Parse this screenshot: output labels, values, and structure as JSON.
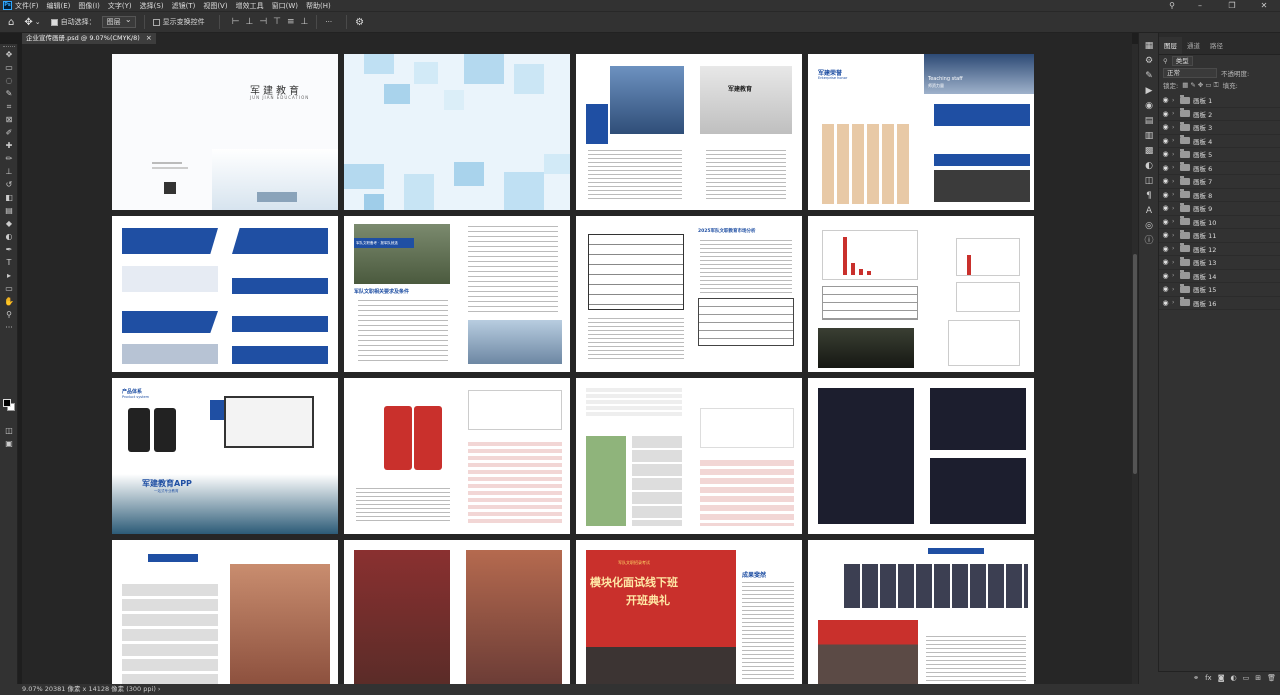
{
  "app": {
    "menu": [
      "文件(F)",
      "编辑(E)",
      "图像(I)",
      "文字(Y)",
      "选择(S)",
      "滤镜(T)",
      "视图(V)",
      "增效工具",
      "窗口(W)",
      "帮助(H)"
    ]
  },
  "options": {
    "auto_select_label": "自动选择：",
    "auto_select_value": "图层",
    "show_transform_label": "显示变换控件",
    "more": "···"
  },
  "document": {
    "tab_title": "企业宣传画册.psd @ 9.07%(CMYK/8)",
    "close": "×"
  },
  "status": {
    "text": "9.07%   20381 像素 x 14128 像素 (300 ppi)   ›"
  },
  "pages": {
    "p1_title": "军建教育",
    "p1_subtitle": "JUN JIAN EDUCATION",
    "p3_name": "军建教育",
    "p4_head": "军建荣誉",
    "p4_head_en": "Enterprise honor",
    "p4_teach": "Teaching staff",
    "p4_teach_cn": "师资力量",
    "p6_banner": "军队文职备考 · 报军队就选",
    "p6_title": "军队文职相关要求及条件",
    "p7_title": "2025军队文职教育市场分析",
    "p9_title": "产品体系",
    "p9_title_en": "Product system",
    "p9_app": "军建教育APP",
    "p9_app_sub": "一站式专业教育",
    "p15_banner": "模块化面试线下班",
    "p15_sub": "开班典礼",
    "p15_top": "军队文职招录考试",
    "p16_title": "成果斐然"
  },
  "panel": {
    "tabs": [
      "图层",
      "通道",
      "路径"
    ],
    "kind": "类型",
    "blend": "正常",
    "opacity_label": "不透明度:",
    "lock_label": "锁定:",
    "fill_label": "填充:",
    "fx": "fx"
  },
  "layers": [
    "画板 1",
    "画板 2",
    "画板 3",
    "画板 4",
    "画板 5",
    "画板 6",
    "画板 7",
    "画板 8",
    "画板 9",
    "画板 10",
    "画板 11",
    "画板 12",
    "画板 13",
    "画板 14",
    "画板 15",
    "画板 16"
  ],
  "colors": {
    "accent_blue": "#1f4fa3",
    "accent_red": "#c9302c",
    "ui_bg": "#323232",
    "canvas_bg": "#262626"
  }
}
